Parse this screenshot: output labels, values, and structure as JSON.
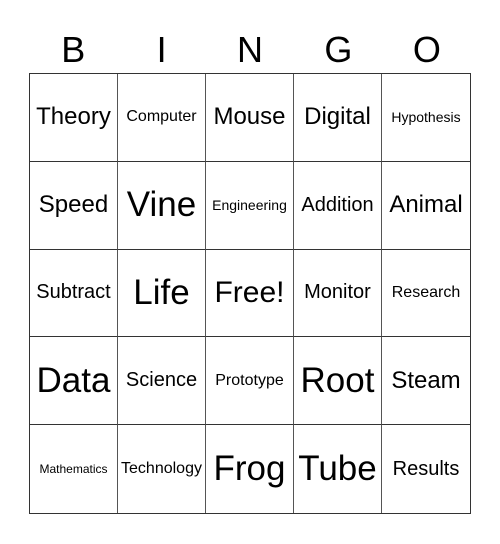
{
  "title_letters": [
    "B",
    "I",
    "N",
    "G",
    "O"
  ],
  "cells": [
    {
      "text": "Theory",
      "size": "large"
    },
    {
      "text": "Computer",
      "size": "small"
    },
    {
      "text": "Mouse",
      "size": "large"
    },
    {
      "text": "Digital",
      "size": "large"
    },
    {
      "text": "Hypothesis",
      "size": "xsmall"
    },
    {
      "text": "Speed",
      "size": "large"
    },
    {
      "text": "Vine",
      "size": "huge"
    },
    {
      "text": "Engineering",
      "size": "xsmall"
    },
    {
      "text": "Addition",
      "size": "medium"
    },
    {
      "text": "Animal",
      "size": "large"
    },
    {
      "text": "Subtract",
      "size": "medium"
    },
    {
      "text": "Life",
      "size": "huge"
    },
    {
      "text": "Free!",
      "size": "xlarge"
    },
    {
      "text": "Monitor",
      "size": "medium"
    },
    {
      "text": "Research",
      "size": "small"
    },
    {
      "text": "Data",
      "size": "huge"
    },
    {
      "text": "Science",
      "size": "medium"
    },
    {
      "text": "Prototype",
      "size": "small"
    },
    {
      "text": "Root",
      "size": "huge"
    },
    {
      "text": "Steam",
      "size": "large"
    },
    {
      "text": "Mathematics",
      "size": "xxsmall"
    },
    {
      "text": "Technology",
      "size": "small"
    },
    {
      "text": "Frog",
      "size": "huge"
    },
    {
      "text": "Tube",
      "size": "huge"
    },
    {
      "text": "Results",
      "size": "medium"
    }
  ]
}
